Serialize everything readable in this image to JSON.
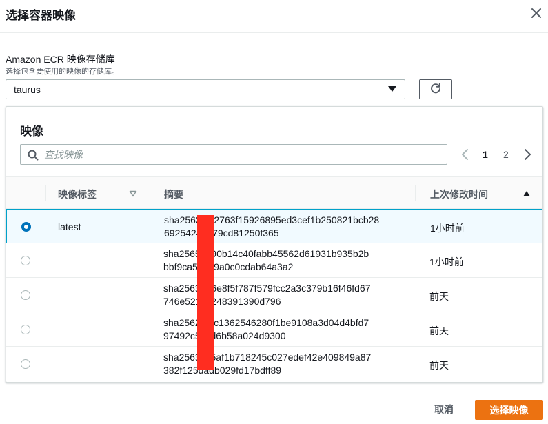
{
  "modal": {
    "title": "选择容器映像",
    "close_icon": "close-icon"
  },
  "repository": {
    "label": "Amazon ECR 映像存储库",
    "description": "选择包含要使用的映像的存储库。",
    "selected": "taurus",
    "refresh_icon": "refresh-icon"
  },
  "images": {
    "title": "映像",
    "search_placeholder": "查找映像",
    "pagination": {
      "current_page": "1",
      "next_page": "2"
    },
    "columns": {
      "tag": "映像标签",
      "digest": "摘要",
      "pushed": "上次修改时间"
    },
    "sort": {
      "column": "pushed",
      "direction": "ascending"
    },
    "rows": [
      {
        "tag": "latest",
        "digest_line1": "sha2563f3c2763f15926895ed3cef1b250821bcb28",
        "digest_line2": "69254247a79cd81250f365",
        "pushed": "1小时前",
        "selected": true
      },
      {
        "tag": "",
        "digest_line1": "sha2565d790b14c40fabb45562d61931b935b2b",
        "digest_line2": "bbf9ca513e9a0c0cdab64a3a2",
        "pushed": "1小时前",
        "selected": false
      },
      {
        "tag": "",
        "digest_line1": "sha2563b56e8f5f787f579fcc2a3c379b16f46fd67",
        "digest_line2": "746e521dc248391390d796",
        "pushed": "前天",
        "selected": false
      },
      {
        "tag": "",
        "digest_line1": "sha25622bfc1362546280f1be9108a3d04d4bfd7",
        "digest_line2": "97492c5c9d6b58a024d9300",
        "pushed": "前天",
        "selected": false
      },
      {
        "tag": "",
        "digest_line1": "sha2563c75af1b718245c027edef42e409849a87",
        "digest_line2": "382f125dadb029fd17bdff89",
        "pushed": "前天",
        "selected": false
      }
    ]
  },
  "footer": {
    "cancel_label": "取消",
    "confirm_label": "选择映像"
  },
  "colors": {
    "primary": "#ec7211",
    "selected_border": "#00a1c9",
    "selected_bg": "#f1faff",
    "radio_checked": "#0073bb",
    "redaction": "#ff2d20"
  }
}
